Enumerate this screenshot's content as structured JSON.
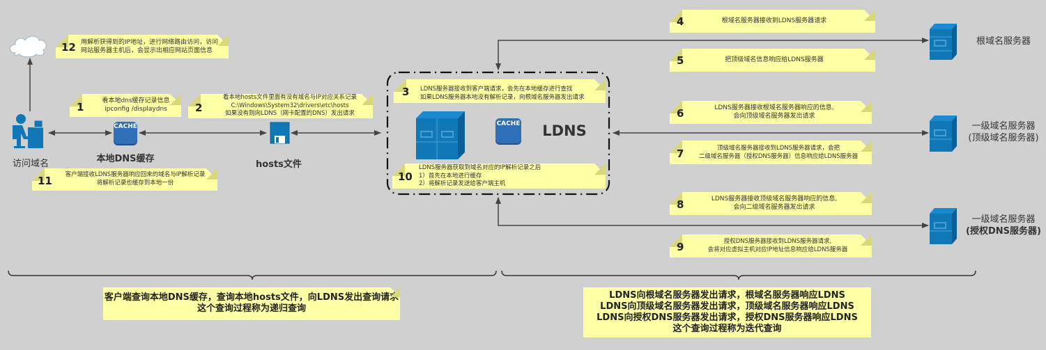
{
  "colors": {
    "background": "#d0d0d0",
    "note_fill": "#ffffa6",
    "icon_blue": "#1178b8",
    "cache_blue": "#2f6fb8",
    "line": "#444444"
  },
  "nodes": {
    "client": {
      "label": "访问域名",
      "icon": "user-at-computer-icon"
    },
    "internet": {
      "icon": "cloud-icon"
    },
    "local_cache": {
      "label": "本地DNS缓存",
      "badge": "CACHE",
      "icon": "cache-icon"
    },
    "hosts_file": {
      "label": "hosts文件",
      "icon": "floppy-disk-icon"
    },
    "ldns": {
      "label": "LDNS",
      "badge": "CACHE",
      "icon": "server-rack-icon"
    },
    "root_server": {
      "label": "根域名服务器",
      "icon": "server-icon"
    },
    "tld_server": {
      "label_line1": "一级域名服务器",
      "label_line2": "(顶级域名服务器)",
      "icon": "server-icon"
    },
    "auth_server": {
      "label_line1": "一级域名服务器",
      "label_line2": "(授权DNS服务器)",
      "icon": "server-icon"
    }
  },
  "steps": {
    "s1": {
      "num": "1",
      "lines": [
        "看本地dns缓存记录信息",
        "ipconfig /displaydns"
      ]
    },
    "s2": {
      "num": "2",
      "lines": [
        "看本地hosts文件里面有没有域名与IP对应关系记录",
        "C:\\Windows\\System32\\drivers\\etc\\hosts",
        "如果没有则向LDNS（网卡配置的DNS）发出请求"
      ]
    },
    "s3": {
      "num": "3",
      "lines": [
        "LDNS服务器接收到客户端请求，会先在本地缓存进行查找",
        "如果LDNS服务器本地没有解析记录，向根域名服务器发出请求"
      ]
    },
    "s4": {
      "num": "4",
      "lines": [
        "根域名服务器接收到LDNS服务器请求"
      ]
    },
    "s5": {
      "num": "5",
      "lines": [
        "把顶级域名信息响应给LDNS服务器"
      ]
    },
    "s6": {
      "num": "6",
      "lines": [
        "LDNS服务器接收根域名服务器响应的信息,",
        "会向顶级域名服务器发出请求"
      ]
    },
    "s7": {
      "num": "7",
      "lines": [
        "顶级域名服务器接收到LDNS服务器请求，会把",
        "二级域名服务器（授权DNS服务器）信息响应给LDNS服务器"
      ]
    },
    "s8": {
      "num": "8",
      "lines": [
        "LDNS服务器接收顶级域名服务器响应的信息,",
        "会向二级域名服务器发出请求"
      ]
    },
    "s9": {
      "num": "9",
      "lines": [
        "授权DNS服务器接收到LDNS服务器请求,",
        "会将对应虚拟主机对应IP地址信息响应给LDNS服务器"
      ]
    },
    "s10": {
      "num": "10",
      "lines": [
        "LDNS服务器获取到域名对应的IP解析记录之后",
        "1）首先在本地进行缓存",
        "2）将解析记录发送给客户端主机"
      ]
    },
    "s11": {
      "num": "11",
      "lines": [
        "客户端接收LDNS服务器响应回来的域名与IP解析记录",
        "将解析记录也缓存到本地一份"
      ]
    },
    "s12": {
      "num": "12",
      "lines": [
        "用解析获得到的IP地址，进行网络路由访问，访问",
        "网站服务器主机后，会显示出相应网站页面信息"
      ]
    }
  },
  "summaries": {
    "recursive": [
      "客户端查询本地DNS缓存，查询本地hosts文件，向LDNS发出查询请求",
      "这个查询过程称为递归查询"
    ],
    "iterative": [
      "LDNS向根域名服务器发出请求，根域名服务器响应LDNS",
      "LDNS向顶级域名服务器发出请求，顶级域名服务器响应LDNS",
      "LDNS向授权DNS服务器发出请求，授权DNS服务器响应LDNS",
      "这个查询过程称为迭代查询"
    ]
  }
}
